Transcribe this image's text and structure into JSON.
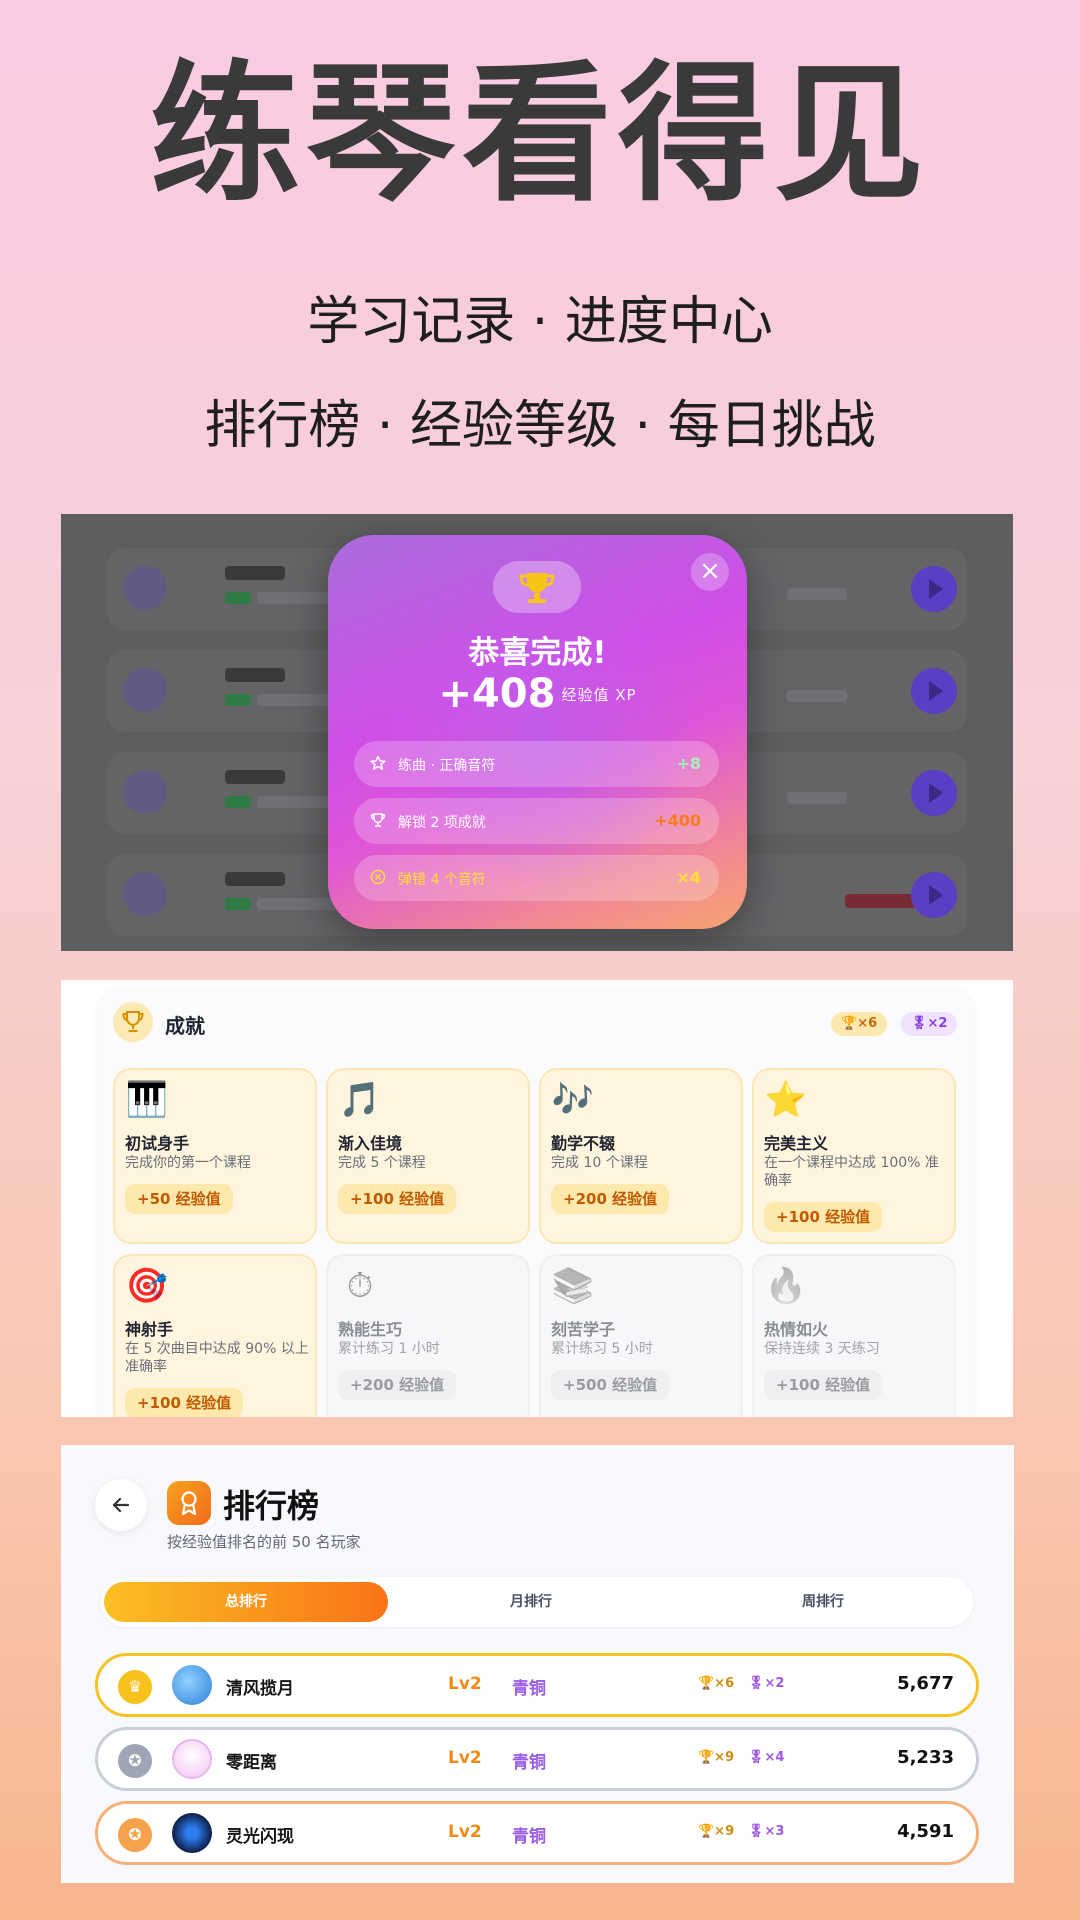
{
  "hero": {
    "title": "练琴看得见",
    "subtitle1": "学习记录 · 进度中心",
    "subtitle2": "排行榜 · 经验等级 · 每日挑战"
  },
  "completion_modal": {
    "title": "恭喜完成!",
    "xp_value": "+408",
    "xp_unit": "经验值 XP",
    "rows": [
      {
        "label": "练曲 · 正确音符",
        "value": "+8",
        "icon": "star-icon"
      },
      {
        "label": "解锁 2 项成就",
        "value": "+400",
        "icon": "trophy-icon"
      },
      {
        "label": "弹错 4 个音符",
        "value": "×4",
        "icon": "error-circle-icon"
      }
    ]
  },
  "achievements": {
    "title": "成就",
    "trophy_count": "×6",
    "medal_count": "×2",
    "items": [
      {
        "icon": "🎹",
        "name": "初试身手",
        "desc": "完成你的第一个课程",
        "xp": "+50 经验值",
        "unlocked": true
      },
      {
        "icon": "🎵",
        "name": "渐入佳境",
        "desc": "完成 5 个课程",
        "xp": "+100 经验值",
        "unlocked": true
      },
      {
        "icon": "🎶",
        "name": "勤学不辍",
        "desc": "完成 10 个课程",
        "xp": "+200 经验值",
        "unlocked": true
      },
      {
        "icon": "⭐",
        "name": "完美主义",
        "desc": "在一个课程中达成 100% 准确率",
        "xp": "+100 经验值",
        "unlocked": true
      },
      {
        "icon": "🎯",
        "name": "神射手",
        "desc": "在 5 次曲目中达成 90% 以上准确率",
        "xp": "+100 经验值",
        "unlocked": true
      },
      {
        "icon": "⏱",
        "name": "熟能生巧",
        "desc": "累计练习 1 小时",
        "xp": "+200 经验值",
        "unlocked": false
      },
      {
        "icon": "📚",
        "name": "刻苦学子",
        "desc": "累计练习 5 小时",
        "xp": "+500 经验值",
        "unlocked": false
      },
      {
        "icon": "🔥",
        "name": "热情如火",
        "desc": "保持连续 3 天练习",
        "xp": "+100 经验值",
        "unlocked": false
      }
    ]
  },
  "leaderboard": {
    "title": "排行榜",
    "subtitle": "按经验值排名的前 50 名玩家",
    "tabs": [
      "总排行",
      "月排行",
      "周排行"
    ],
    "rows": [
      {
        "name": "清风揽月",
        "level": "Lv2",
        "tier": "青铜",
        "trophies": "🏆×6",
        "medals": "🎖×2",
        "score": "5,677"
      },
      {
        "name": "零距离",
        "level": "Lv2",
        "tier": "青铜",
        "trophies": "🏆×9",
        "medals": "🎖×4",
        "score": "5,233"
      },
      {
        "name": "灵光闪现",
        "level": "Lv2",
        "tier": "青铜",
        "trophies": "🏆×9",
        "medals": "🎖×3",
        "score": "4,591"
      }
    ]
  }
}
